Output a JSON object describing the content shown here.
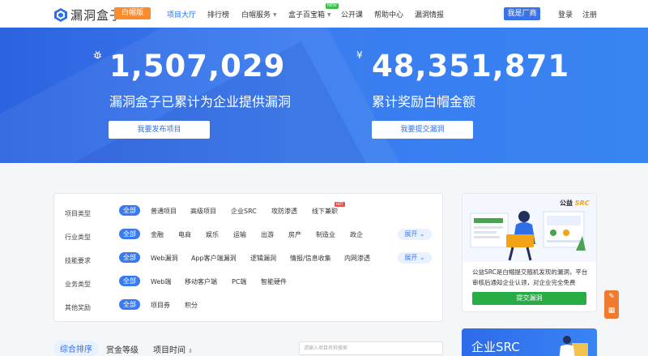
{
  "nav": {
    "logo_text": "漏洞盒子",
    "badge": "白帽版",
    "items": [
      {
        "label": "项目大厅",
        "active": true
      },
      {
        "label": "排行榜"
      },
      {
        "label": "白帽服务",
        "caret": true
      },
      {
        "label": "盒子百宝箱",
        "caret": true,
        "tag": "NEW"
      },
      {
        "label": "公开课"
      },
      {
        "label": "帮助中心"
      },
      {
        "label": "漏洞情报"
      }
    ],
    "vendor_button": "我是厂商",
    "login": "登录",
    "register": "注册"
  },
  "hero": {
    "left": {
      "icon": "bug-icon",
      "number": "1,507,029",
      "label": "漏洞盒子已累计为企业提供漏洞",
      "button": "我要发布项目"
    },
    "right": {
      "icon": "yen-icon",
      "number": "48,351,871",
      "label": "累计奖励白帽金额",
      "button": "我要提交漏洞"
    }
  },
  "filters": [
    {
      "label": "项目类型",
      "all": "全部",
      "options": [
        "普通项目",
        "高级项目",
        "企业SRC",
        "攻防渗透",
        "线下兼职"
      ],
      "hot_tag": "HOT"
    },
    {
      "label": "行业类型",
      "all": "全部",
      "options": [
        "金融",
        "电商",
        "娱乐",
        "运输",
        "出游",
        "房产",
        "制造业",
        "政企"
      ],
      "expand": "展开"
    },
    {
      "label": "技能要求",
      "all": "全部",
      "options": [
        "Web漏洞",
        "App客户端漏洞",
        "逻辑漏洞",
        "情报/信息收集",
        "内网渗透"
      ],
      "expand": "展开"
    },
    {
      "label": "业务类型",
      "all": "全部",
      "options": [
        "Web端",
        "移动客户端",
        "PC端",
        "智能硬件"
      ]
    },
    {
      "label": "其他奖励",
      "all": "全部",
      "options": [
        "项目券",
        "积分"
      ]
    }
  ],
  "sort": {
    "items": [
      "综合排序",
      "赏金等级",
      "项目时间"
    ],
    "search_placeholder": "请输入项目名称搜索"
  },
  "side": {
    "gongyi_prefix": "公益",
    "gongyi_src": "SRC",
    "description": "公益SRC是白帽提交随机发现的漏洞，平台审核后通知企业认领，对企业完全免费",
    "submit_button": "提交漏洞",
    "enterprise_title": "企业SRC"
  },
  "colors": {
    "primary": "#3a7af0",
    "orange": "#fa8c2c",
    "green": "#28ad46"
  }
}
